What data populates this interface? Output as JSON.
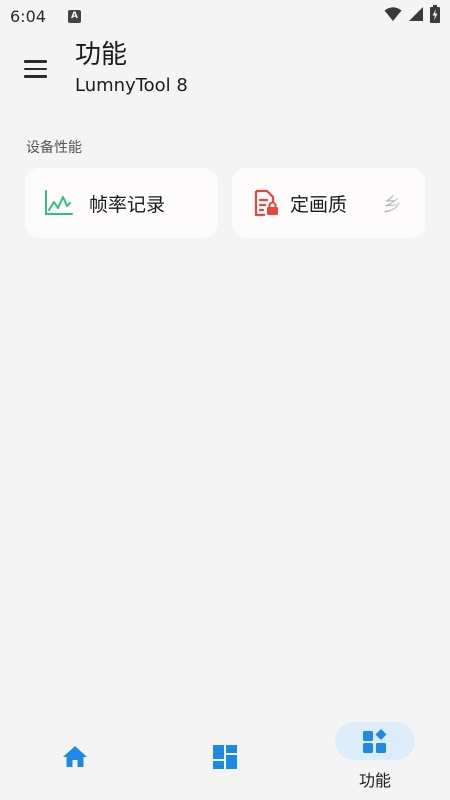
{
  "status_bar": {
    "time": "6:04",
    "notification_badge": "A",
    "icons": [
      "wifi-icon",
      "cellular-signal-icon",
      "battery-charging-icon"
    ]
  },
  "app_bar": {
    "menu_icon": "hamburger-menu-icon",
    "title": "功能",
    "subtitle": "LumnyTool 8"
  },
  "section": {
    "header": "设备性能",
    "cards": [
      {
        "label": "帧率记录",
        "icon": "line-chart-icon",
        "icon_color": "#2ec27e"
      },
      {
        "label": "定画质",
        "icon": "locked-document-icon",
        "icon_color": "#e5483b"
      }
    ],
    "next_card_clipped_glyph": "乡"
  },
  "bottom_nav": {
    "accent_color": "#1e88e5",
    "items": [
      {
        "icon": "home-icon",
        "label": ""
      },
      {
        "icon": "dashboard-grid-icon",
        "label": ""
      },
      {
        "icon": "widgets-icon",
        "label": "功能",
        "selected": true
      }
    ]
  },
  "colors": {
    "background": "#f4f4f4",
    "card_background": "#fdfbfc",
    "nav_selected_pill": "#dcecfb"
  }
}
